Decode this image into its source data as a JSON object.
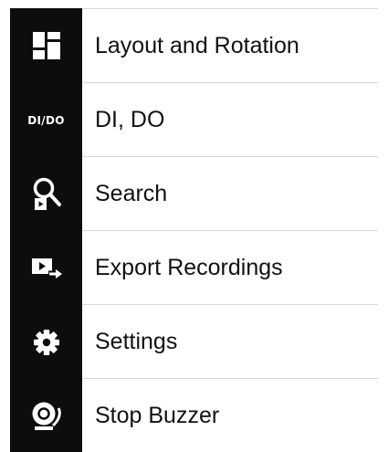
{
  "menu": {
    "items": [
      {
        "icon": "layout-icon",
        "label": "Layout and Rotation"
      },
      {
        "icon": "di-do-icon",
        "icon_text": "DI/DO",
        "label": "DI, DO"
      },
      {
        "icon": "search-playback-icon",
        "label": "Search"
      },
      {
        "icon": "export-recordings-icon",
        "label": "Export Recordings"
      },
      {
        "icon": "gear-icon",
        "label": "Settings"
      },
      {
        "icon": "buzzer-icon",
        "label": "Stop Buzzer"
      }
    ]
  },
  "colors": {
    "icon_background": "#0d0d0d",
    "icon_foreground": "#ffffff",
    "label_text": "#111111",
    "divider": "#d6d6d6"
  }
}
